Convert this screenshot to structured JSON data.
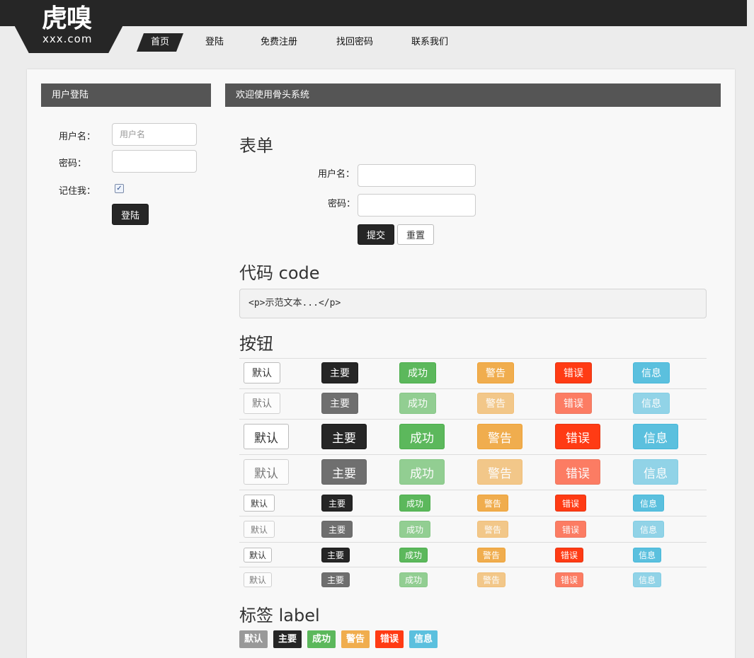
{
  "logo": {
    "main": "虎嗅",
    "sub": "xxx.com"
  },
  "nav": {
    "items": [
      {
        "label": "首页"
      },
      {
        "label": "登陆"
      },
      {
        "label": "免费注册"
      },
      {
        "label": "找回密码"
      },
      {
        "label": "联系我们"
      }
    ]
  },
  "login": {
    "header": "用户登陆",
    "username_label": "用户名：",
    "username_placeholder": "用户名",
    "password_label": "密码：",
    "remember_label": "记住我：",
    "remember_checked": true,
    "submit": "登陆"
  },
  "main": {
    "header": "欢迎使用骨头系统",
    "form": {
      "title": "表单",
      "username_label": "用户名：",
      "password_label": "密码：",
      "submit": "提交",
      "reset": "重置"
    },
    "code": {
      "title": "代码 code",
      "text": "<p>示范文本...</p>"
    },
    "buttons": {
      "title": "按钮",
      "labels": {
        "default": "默认",
        "primary": "主要",
        "success": "成功",
        "warning": "警告",
        "error": "错误",
        "info": "信息"
      }
    },
    "labels": {
      "title": "标签 label",
      "items": [
        {
          "text": "默认",
          "color": "#999999"
        },
        {
          "text": "主要",
          "color": "#262626"
        },
        {
          "text": "成功",
          "color": "#5cb85c"
        },
        {
          "text": "警告",
          "color": "#f0ad4e"
        },
        {
          "text": "错误",
          "color": "#ff3b14"
        },
        {
          "text": "信息",
          "color": "#5bc0de"
        }
      ]
    }
  },
  "colors": {
    "dark": "#262626",
    "success": "#5cb85c",
    "warning": "#f0ad4e",
    "error": "#ff3b14",
    "info": "#5bc0de"
  }
}
